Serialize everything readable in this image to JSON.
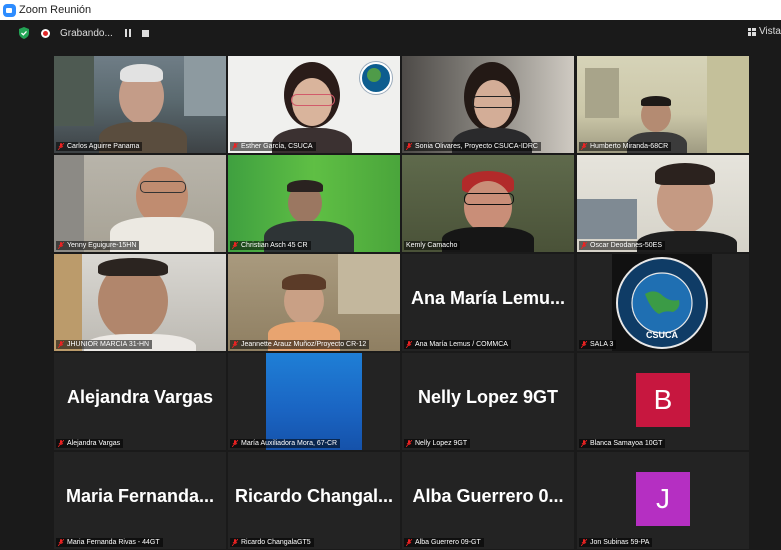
{
  "window": {
    "title": "Zoom Reunión"
  },
  "toolbar": {
    "recording_label": "Grabando...",
    "view_label": "Vista"
  },
  "colors": {
    "active_border": "#c9e265",
    "avatar_b": "#c7173f",
    "avatar_j": "#b52fc2",
    "accent": "#2d8cff"
  },
  "tiles": [
    {
      "name": "Carlos Aguirre Panama"
    },
    {
      "name": "Esther García, CSUCA"
    },
    {
      "name": "Sonia Olivares, Proyecto CSUCA-IDRC"
    },
    {
      "name": "Humberto Miranda-68CR"
    },
    {
      "name": "Yenny Eguigure-15HN"
    },
    {
      "name": "Christian Asch 45 CR"
    },
    {
      "name": "Kemly Camacho"
    },
    {
      "name": "Oscar Deodanes-50ES"
    },
    {
      "name": "JHUNIOR MARCIA 31-HN"
    },
    {
      "name": "Jeannette Arauz Muñoz/Proyecto CR-12"
    },
    {
      "name": "Ana María Lemus / COMMCA",
      "display": "Ana María Lemu..."
    },
    {
      "name": "SALA 3",
      "logo_text": "CSUCA"
    },
    {
      "name": "Alejandra Vargas",
      "display": "Alejandra Vargas"
    },
    {
      "name": "María Auxiliadora Mora, 67-CR"
    },
    {
      "name": "Nelly Lopez 9GT",
      "display": "Nelly Lopez 9GT"
    },
    {
      "name": "Blanca Samayoa 10GT",
      "avatar": "B"
    },
    {
      "name": "Maria Fernanda Rivas - 44GT",
      "display": "Maria Fernanda..."
    },
    {
      "name": "Ricardo ChangalaGT5",
      "display": "Ricardo Changal..."
    },
    {
      "name": "Alba Guerrero 09-GT",
      "display": "Alba Guerrero 0..."
    },
    {
      "name": "Jon Subinas 59-PA",
      "avatar": "J"
    }
  ]
}
